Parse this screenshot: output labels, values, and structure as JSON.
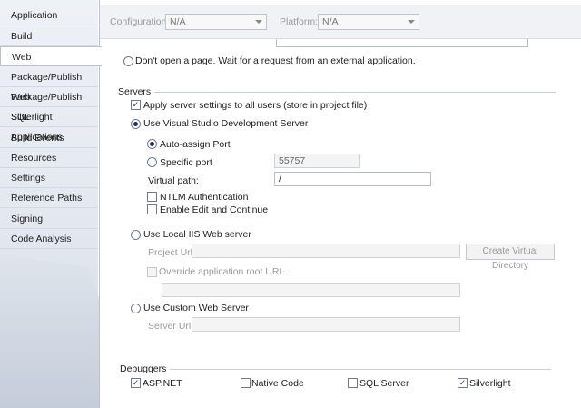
{
  "sidebar": {
    "items": [
      {
        "label": "Application"
      },
      {
        "label": "Build"
      },
      {
        "label": "Web"
      },
      {
        "label": "Package/Publish Web"
      },
      {
        "label": "Package/Publish SQL"
      },
      {
        "label": "Silverlight Applications"
      },
      {
        "label": "Build Events"
      },
      {
        "label": "Resources"
      },
      {
        "label": "Settings"
      },
      {
        "label": "Reference Paths"
      },
      {
        "label": "Signing"
      },
      {
        "label": "Code Analysis"
      }
    ],
    "selected": "Web"
  },
  "toolbar": {
    "configuration_label": "Configuration:",
    "configuration_value": "N/A",
    "platform_label": "Platform:",
    "platform_value": "N/A"
  },
  "start_action": {
    "dont_open_label": "Don't open a page.  Wait for a request from an external application."
  },
  "servers": {
    "title": "Servers",
    "apply_all_label": "Apply server settings to all users (store in project file)",
    "vs_dev_server_label": "Use Visual Studio Development Server",
    "auto_assign_label": "Auto-assign Port",
    "specific_port_label": "Specific port",
    "specific_port_value": "55757",
    "virtual_path_label": "Virtual path:",
    "virtual_path_value": "/",
    "ntlm_label": "NTLM Authentication",
    "edit_continue_label": "Enable Edit and Continue",
    "local_iis_label": "Use Local IIS Web server",
    "project_url_label": "Project Url:",
    "create_vdir_label": "Create Virtual Directory",
    "override_root_label": "Override application root URL",
    "custom_server_label": "Use Custom Web Server",
    "server_url_label": "Server Url:"
  },
  "debuggers": {
    "title": "Debuggers",
    "aspnet_label": "ASP.NET",
    "native_label": "Native Code",
    "sql_label": "SQL Server",
    "silverlight_label": "Silverlight"
  }
}
